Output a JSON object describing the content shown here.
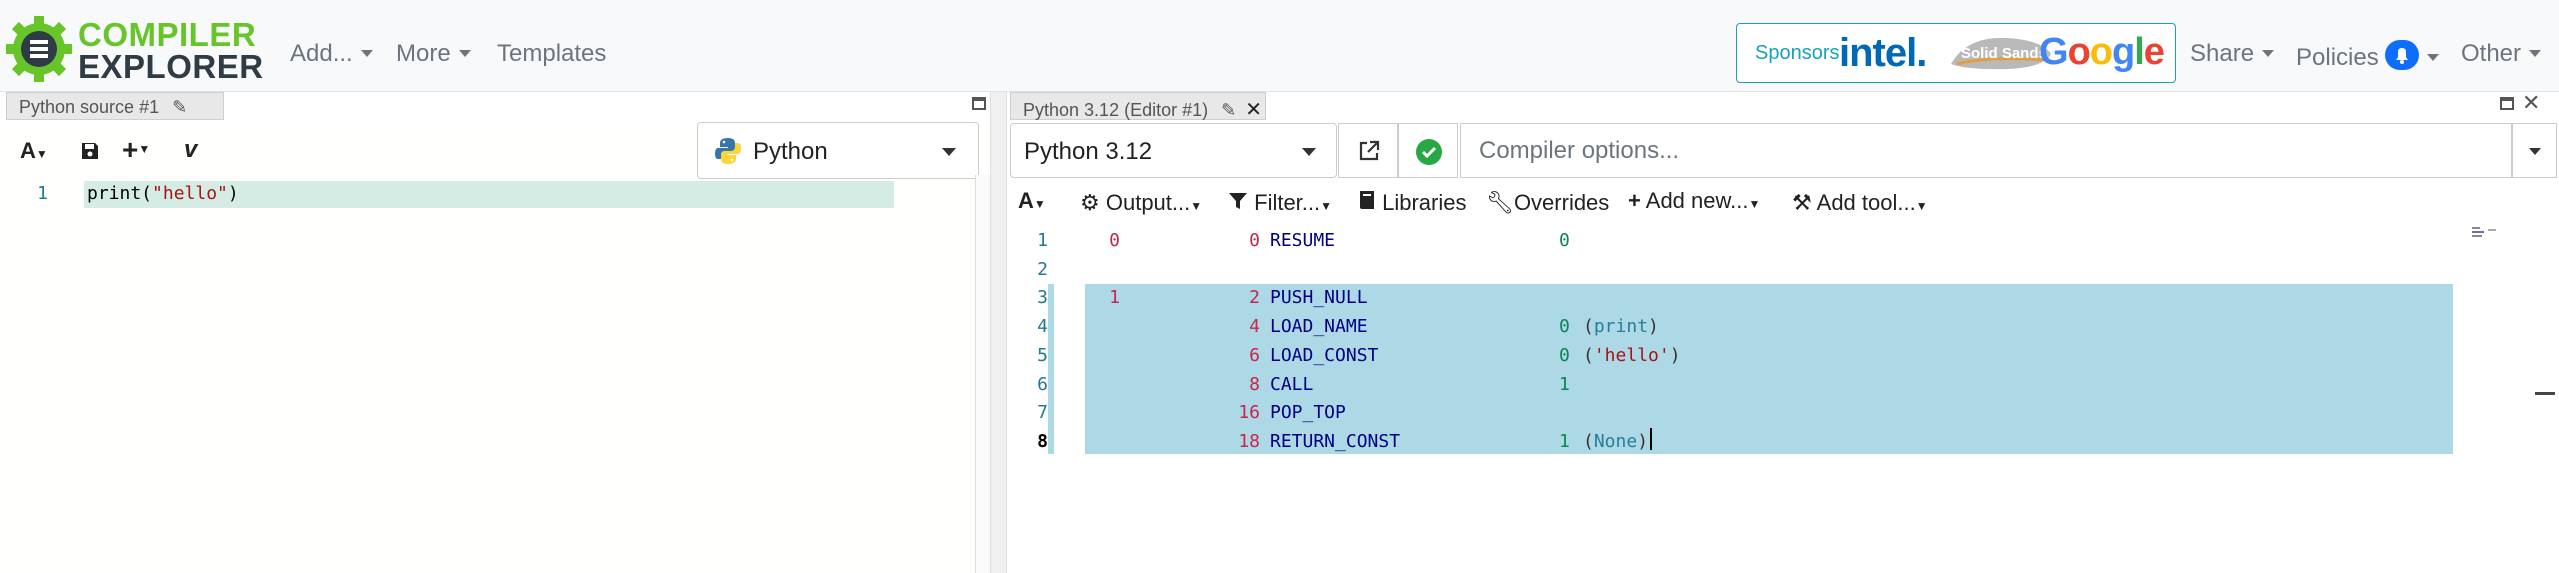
{
  "navbar": {
    "logo_line1": "COMPILER",
    "logo_line2": "EXPLORER",
    "menu": {
      "add": "Add...",
      "more": "More",
      "templates": "Templates"
    },
    "sponsors": {
      "label": "Sponsors",
      "intel": "intel.",
      "solid_sands": "Solid Sands",
      "google": "Google"
    },
    "right_menu": {
      "share": "Share",
      "policies": "Policies",
      "other": "Other"
    }
  },
  "left_pane": {
    "tab_title": "Python source #1",
    "toolbar": {
      "font": "A",
      "add": "+",
      "vim": "v"
    },
    "language": "Python",
    "code_lines": [
      {
        "num": "1",
        "text": "print(\"hello\")"
      }
    ]
  },
  "right_pane": {
    "tab_title": "Python 3.12 (Editor #1)",
    "compiler": "Python 3.12",
    "compiler_options_placeholder": "Compiler options...",
    "toolbar": {
      "font": "A",
      "output": "Output...",
      "filter": "Filter...",
      "libraries": "Libraries",
      "overrides": "Overrides",
      "add_new": "Add new...",
      "add_tool": "Add tool..."
    },
    "asm_lines": [
      {
        "num": "1",
        "src": "0",
        "off": "0",
        "op": "RESUME",
        "arg": "0",
        "extra": ""
      },
      {
        "num": "2",
        "src": "",
        "off": "",
        "op": "",
        "arg": "",
        "extra": ""
      },
      {
        "num": "3",
        "src": "1",
        "off": "2",
        "op": "PUSH_NULL",
        "arg": "",
        "extra": ""
      },
      {
        "num": "4",
        "src": "",
        "off": "4",
        "op": "LOAD_NAME",
        "arg": "0",
        "extra": "print"
      },
      {
        "num": "5",
        "src": "",
        "off": "6",
        "op": "LOAD_CONST",
        "arg": "0",
        "extra": "'hello'"
      },
      {
        "num": "6",
        "src": "",
        "off": "8",
        "op": "CALL",
        "arg": "1",
        "extra": ""
      },
      {
        "num": "7",
        "src": "",
        "off": "16",
        "op": "POP_TOP",
        "arg": "",
        "extra": ""
      },
      {
        "num": "8",
        "src": "",
        "off": "18",
        "op": "RETURN_CONST",
        "arg": "1",
        "extra": "None"
      }
    ]
  }
}
